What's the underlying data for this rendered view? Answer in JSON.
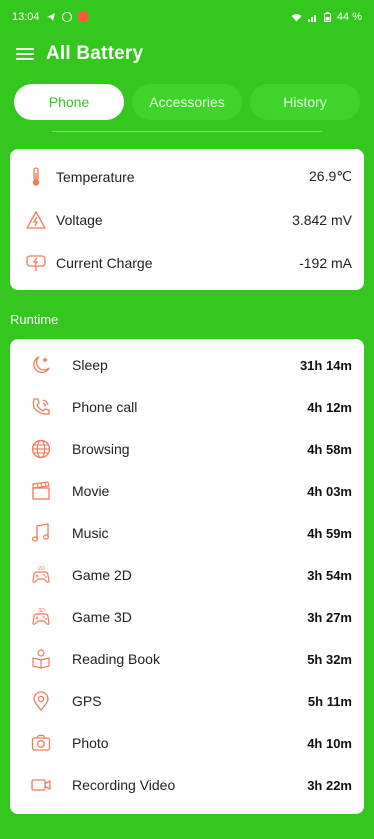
{
  "status_bar": {
    "time": "13:04",
    "signal_text": "ᴴ",
    "battery_percent": "44 %"
  },
  "app_bar": {
    "title": "All Battery"
  },
  "tabs": [
    {
      "label": "Phone",
      "active": true
    },
    {
      "label": "Accessories",
      "active": false
    },
    {
      "label": "History",
      "active": false
    }
  ],
  "info": [
    {
      "icon": "thermometer-icon",
      "label": "Temperature",
      "value": "26.9℃"
    },
    {
      "icon": "voltage-icon",
      "label": "Voltage",
      "value": "3.842 mV"
    },
    {
      "icon": "charger-icon",
      "label": "Current Charge",
      "value": "-192 mA"
    }
  ],
  "runtime_section_label": "Runtime",
  "runtime": [
    {
      "icon": "sleep-icon",
      "label": "Sleep",
      "value": "31h 14m"
    },
    {
      "icon": "phone-call-icon",
      "label": "Phone call",
      "value": "4h 12m"
    },
    {
      "icon": "globe-icon",
      "label": "Browsing",
      "value": "4h 58m"
    },
    {
      "icon": "clapperboard-icon",
      "label": "Movie",
      "value": "4h 03m"
    },
    {
      "icon": "music-note-icon",
      "label": "Music",
      "value": "4h 59m"
    },
    {
      "icon": "gamepad-2d-icon",
      "label": "Game 2D",
      "value": "3h 54m"
    },
    {
      "icon": "gamepad-3d-icon",
      "label": "Game 3D",
      "value": "3h 27m"
    },
    {
      "icon": "book-icon",
      "label": "Reading Book",
      "value": "5h 32m"
    },
    {
      "icon": "location-pin-icon",
      "label": "GPS",
      "value": "5h 11m"
    },
    {
      "icon": "camera-icon",
      "label": "Photo",
      "value": "4h 10m"
    },
    {
      "icon": "video-camera-icon",
      "label": "Recording Video",
      "value": "3h 22m"
    }
  ],
  "colors": {
    "accent": "#34c81e",
    "icon": "#f07a5c"
  }
}
